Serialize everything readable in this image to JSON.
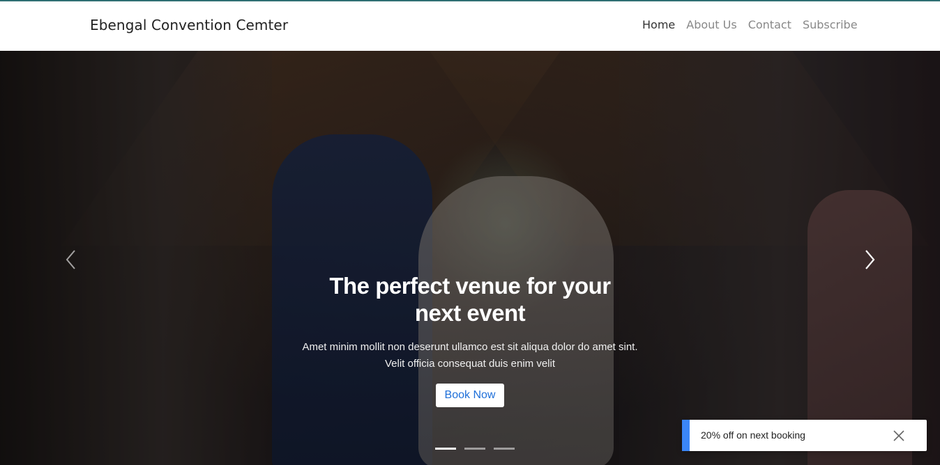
{
  "navbar": {
    "brand": "Ebengal Convention Cemter",
    "items": [
      {
        "label": "Home",
        "active": true
      },
      {
        "label": "About Us",
        "active": false
      },
      {
        "label": "Contact",
        "active": false
      },
      {
        "label": "Subscribe",
        "active": false
      }
    ]
  },
  "hero": {
    "headline": "The perfect venue for your next event",
    "subtext_line1": "Amet minim mollit non deserunt ullamco est sit aliqua dolor do amet sint.",
    "subtext_line2": "Velit officia consequat duis enim velit",
    "cta_label": "Book Now",
    "prev_icon": "chevron-left-icon",
    "next_icon": "chevron-right-icon",
    "slide_count": 3,
    "active_slide": 1
  },
  "toast": {
    "message": "20% off on next booking",
    "close_icon": "close-icon",
    "accent_color": "#3b86f7"
  },
  "colors": {
    "top_accent": "#2f6f73",
    "cta_text": "#1e6fd9"
  }
}
